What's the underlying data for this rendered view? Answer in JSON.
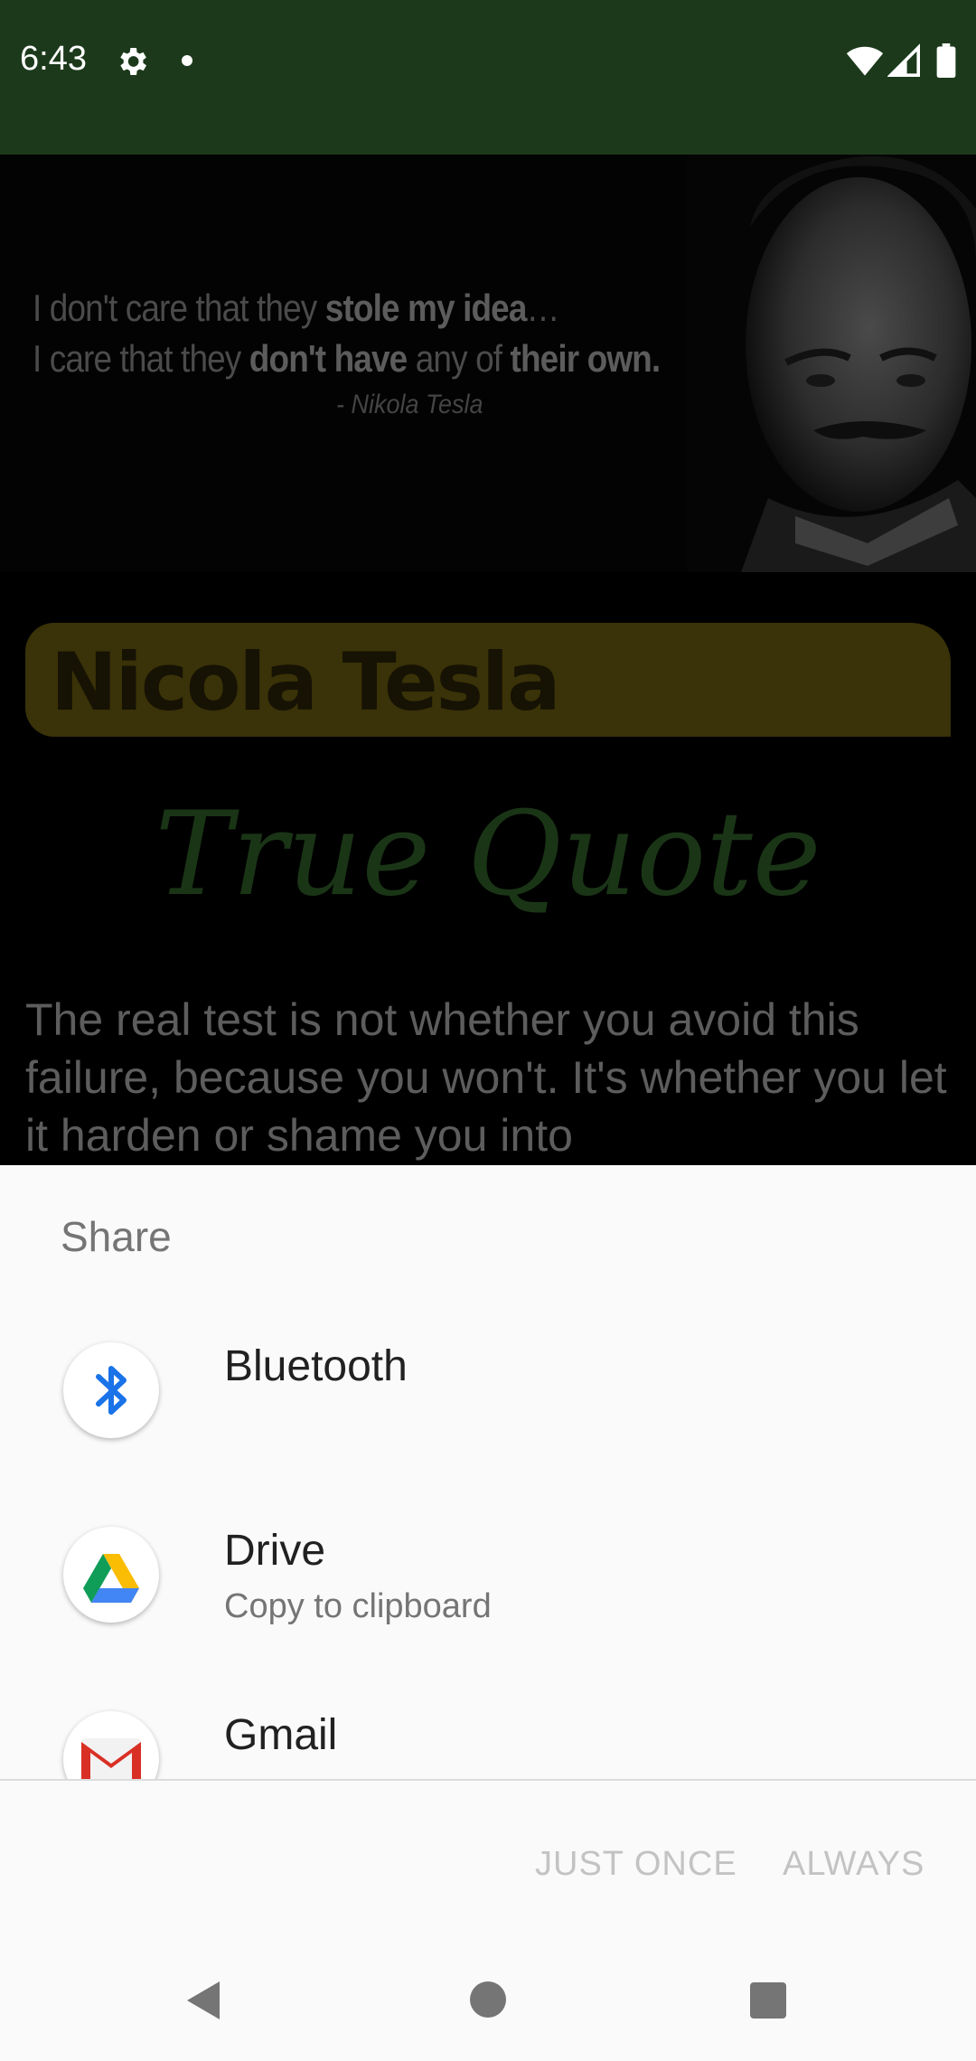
{
  "status_bar": {
    "time": "6:43",
    "icons": [
      "gear-icon",
      "notification-dot",
      "wifi-icon",
      "cell-signal-icon",
      "battery-icon"
    ],
    "background": "#1c3a1b"
  },
  "app": {
    "hero": {
      "quote_line1_a": "I don't care that they ",
      "quote_line1_b": "stole my idea",
      "quote_line1_c": "…",
      "quote_line2_a": "I care that they ",
      "quote_line2_b": "don't have",
      "quote_line2_c": " any of ",
      "quote_line2_d": "their own.",
      "author": "- Nikola Tesla"
    },
    "title": "Nicola Tesla",
    "subtitle": "True Quote",
    "quote_body": "The real test is not whether you avoid this failure, because you won't. It's whether you let it harden or shame you into"
  },
  "share_sheet": {
    "title": "Share",
    "items": [
      {
        "name": "Bluetooth",
        "subtitle": "",
        "icon": "bluetooth-icon"
      },
      {
        "name": "Drive",
        "subtitle": "Copy to clipboard",
        "icon": "google-drive-icon"
      },
      {
        "name": "Gmail",
        "subtitle": "",
        "icon": "gmail-icon"
      }
    ],
    "buttons": {
      "just_once": "JUST ONCE",
      "always": "ALWAYS"
    }
  },
  "nav_bar": {
    "icons": [
      "back-icon",
      "home-icon",
      "recents-icon"
    ]
  }
}
